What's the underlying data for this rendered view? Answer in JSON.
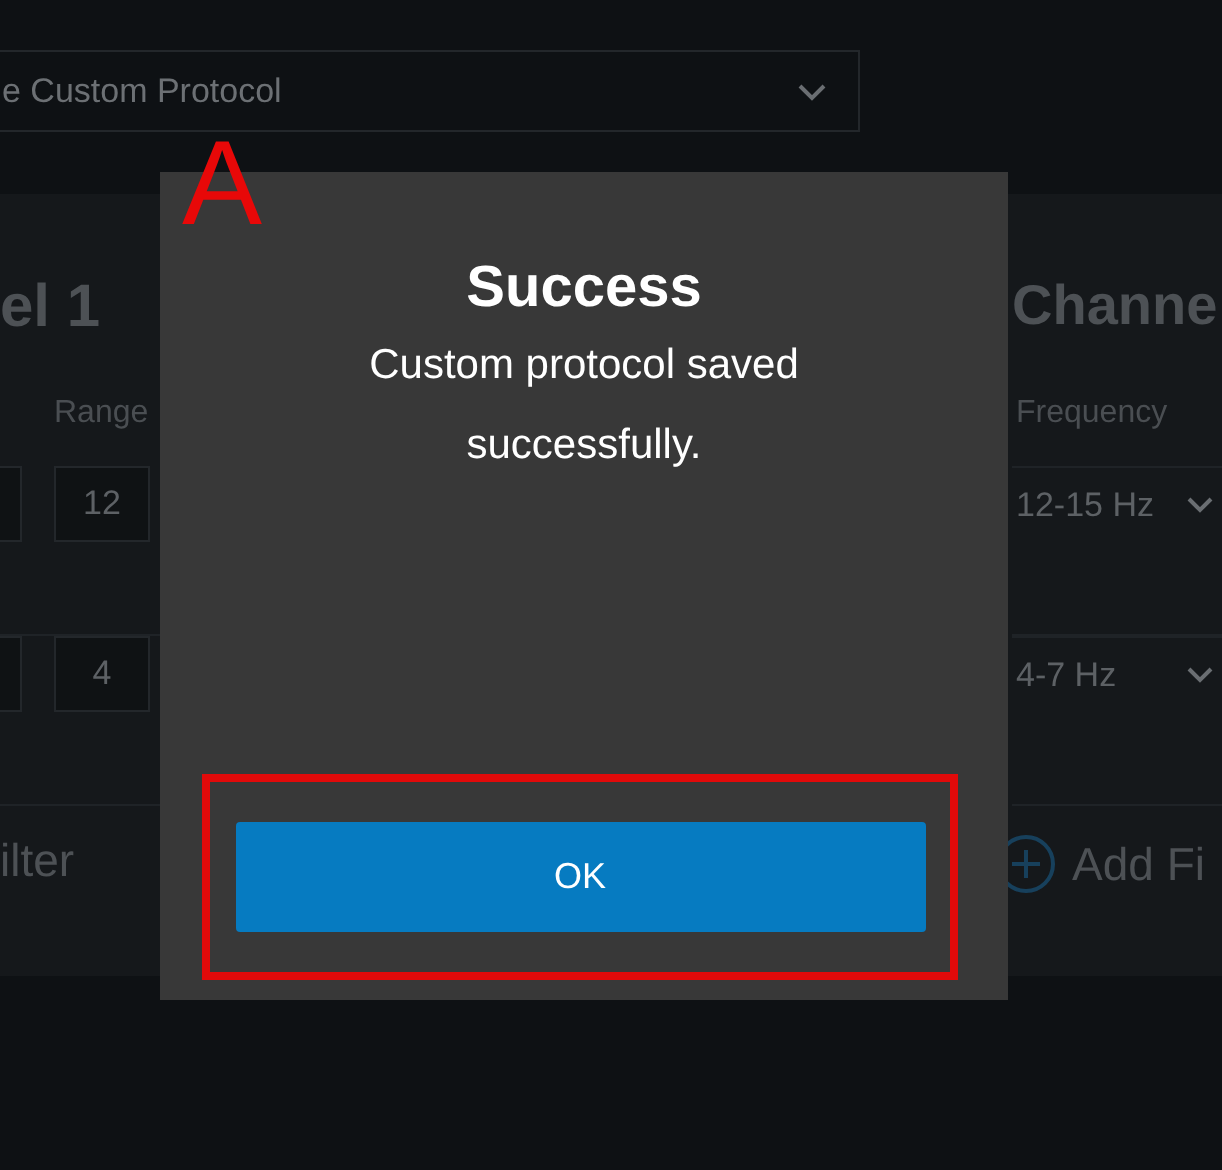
{
  "protocol_dropdown": {
    "value": "e Custom Protocol"
  },
  "left_panel": {
    "title": "el 1",
    "column_label": "Range",
    "rows": [
      {
        "range": "12"
      },
      {
        "range": "4"
      }
    ],
    "add_button": "ilter"
  },
  "right_panel": {
    "title": "Channe",
    "column_label": "Frequency",
    "rows": [
      {
        "frequency": "12-15 Hz"
      },
      {
        "frequency": "4-7 Hz"
      }
    ],
    "add_button": "Add Fi"
  },
  "dialog": {
    "title": "Success",
    "message": "Custom protocol saved successfully.",
    "button": "OK"
  },
  "annotation": {
    "label": "A"
  }
}
